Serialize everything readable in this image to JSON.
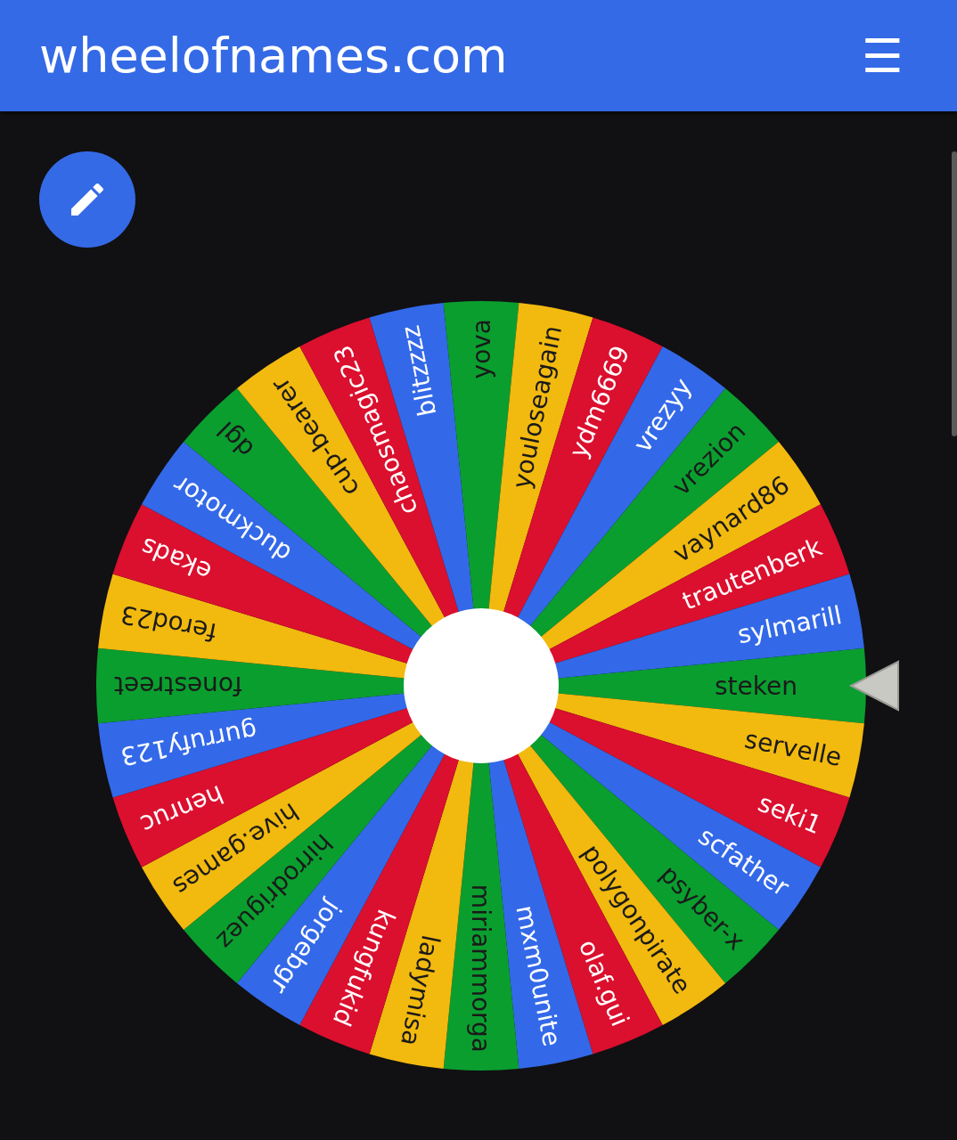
{
  "header": {
    "title": "wheelofnames.com",
    "menu_icon": "☰"
  },
  "wheel": {
    "segments": [
      {
        "name": "steken"
      },
      {
        "name": "servelle"
      },
      {
        "name": "seki1"
      },
      {
        "name": "scfather"
      },
      {
        "name": "psyber-x"
      },
      {
        "name": "polygonpirate"
      },
      {
        "name": "olaf.gui"
      },
      {
        "name": "mxm0unite"
      },
      {
        "name": "miriammorga"
      },
      {
        "name": "ladymisa"
      },
      {
        "name": "kungfukid"
      },
      {
        "name": "jorgebgr"
      },
      {
        "name": "hirrodriguez"
      },
      {
        "name": "hive.games"
      },
      {
        "name": "henruc"
      },
      {
        "name": "gurrufy123"
      },
      {
        "name": "fonestreet"
      },
      {
        "name": "ferod23"
      },
      {
        "name": "ekads"
      },
      {
        "name": "duckmotor"
      },
      {
        "name": "dgl"
      },
      {
        "name": "cup-bearer"
      },
      {
        "name": "chaosmagic23"
      },
      {
        "name": "blitzzzz"
      },
      {
        "name": "yova"
      },
      {
        "name": "youloseagain"
      },
      {
        "name": "ydm6669"
      },
      {
        "name": "vrezyy"
      },
      {
        "name": "vrezion"
      },
      {
        "name": "vaynard86"
      },
      {
        "name": "trautenberk"
      },
      {
        "name": "sylmarill"
      }
    ]
  }
}
